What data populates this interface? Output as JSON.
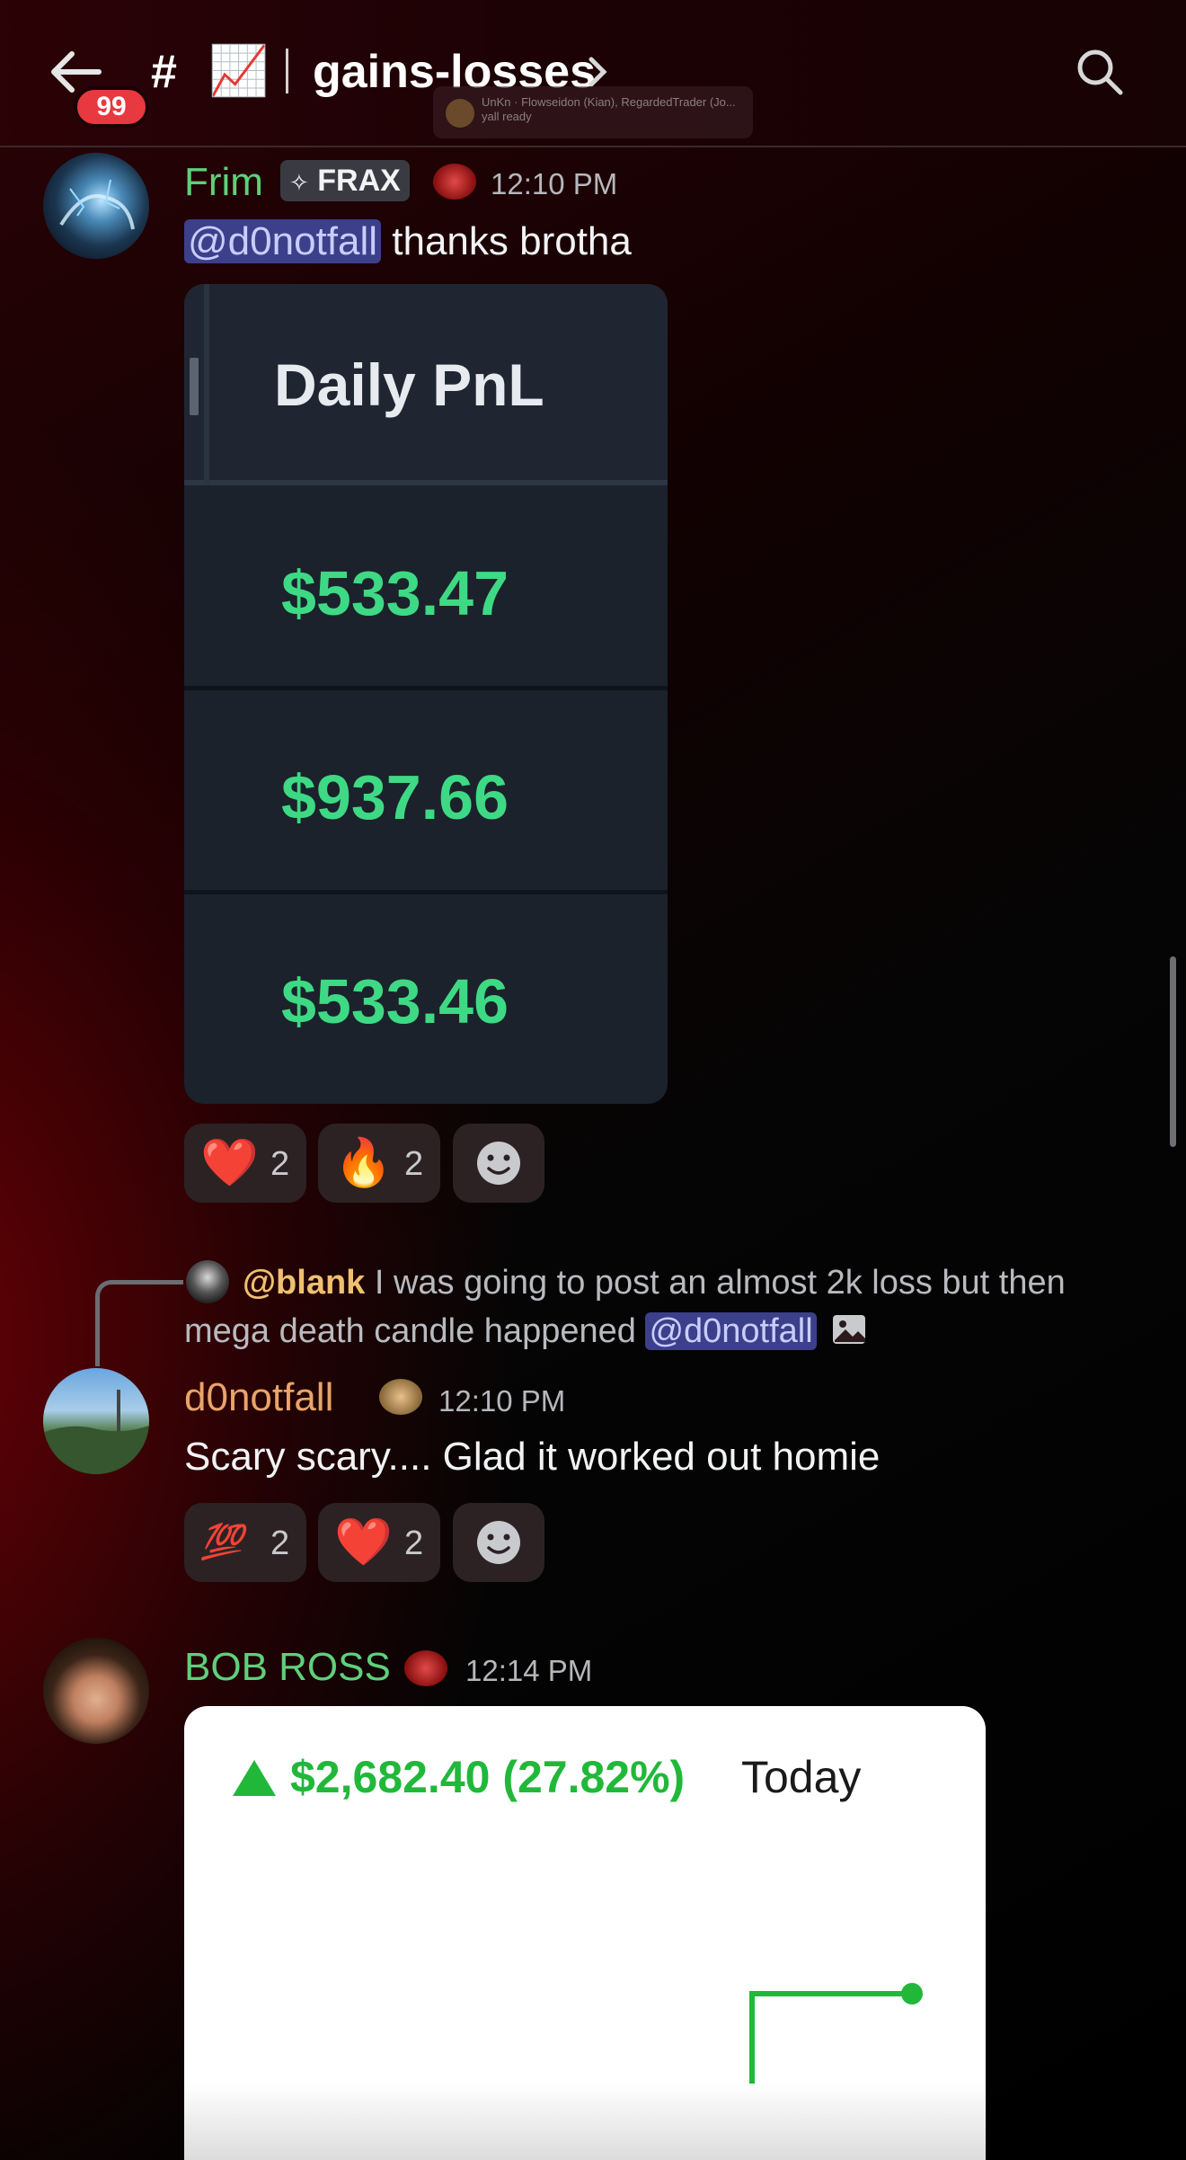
{
  "header": {
    "back_label": "Back",
    "unread_badge": "99",
    "channel_hash": "#",
    "channel_emoji": "📈",
    "channel_name": "gains-losses",
    "typing_indicator": "UnKn · Flowseidon (Kian), RegardedTrader (Jo...",
    "typing_subtext": "yall ready"
  },
  "messages": [
    {
      "username": "Frim",
      "username_color": "#5fd07a",
      "tag": "FRAX",
      "time": "12:10 PM",
      "mention": "@d0notfall",
      "text": " thanks brotha",
      "attachment": {
        "header": "Daily PnL",
        "rows": [
          "$533.47",
          "$937.66",
          "$533.46"
        ]
      },
      "reactions": [
        {
          "emoji": "❤️",
          "count": "2"
        },
        {
          "emoji": "🔥",
          "count": "2"
        }
      ]
    },
    {
      "reply": {
        "author": "@blank",
        "text_line1": " I was going to post an almost 2k loss but then",
        "text_line2": "mega death candle happened ",
        "mention": "@d0notfall"
      },
      "username": "d0notfall",
      "username_color": "#e9a46a",
      "time": "12:10 PM",
      "text": "Scary scary.... Glad it worked out homie",
      "reactions": [
        {
          "emoji": "💯",
          "count": "2"
        },
        {
          "emoji": "❤️",
          "count": "2"
        }
      ]
    },
    {
      "username": "BOB ROSS",
      "username_color": "#5fd07a",
      "time": "12:14 PM",
      "attachment": {
        "gain": "$2,682.40 (27.82%)",
        "period": "Today"
      }
    }
  ],
  "colors": {
    "accent_green": "#3ed984",
    "mention_bg": "#3c3f8a",
    "badge_red": "#e7393f"
  }
}
